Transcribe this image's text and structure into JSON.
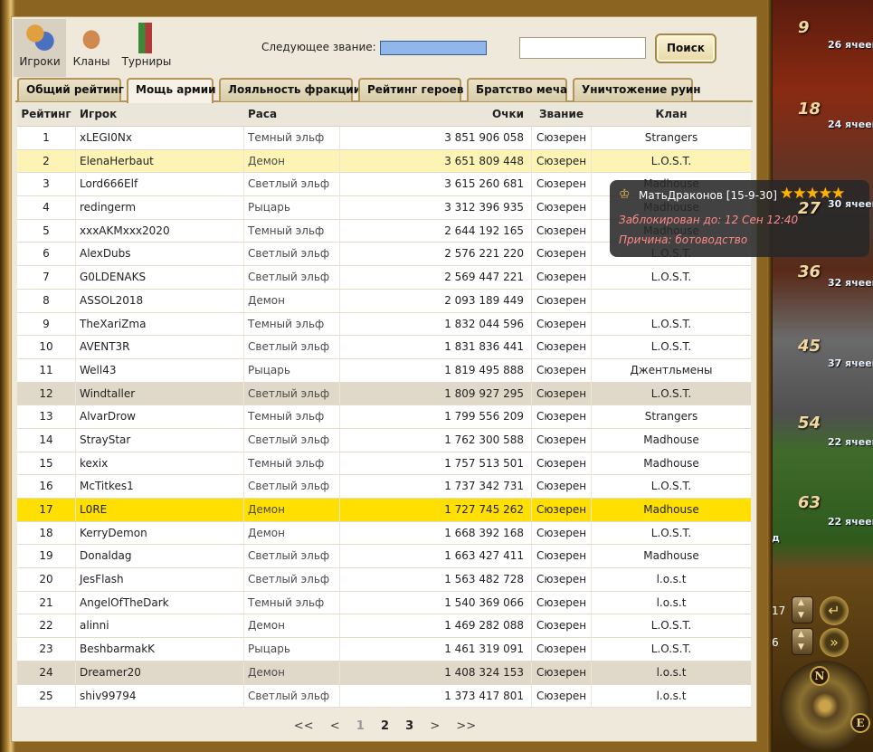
{
  "nav": {
    "players_label": "Игроки",
    "clans_label": "Кланы",
    "tournaments_label": "Турниры"
  },
  "next_rank_label": "Следующее звание:",
  "next_rank_progress": 1.0,
  "search": {
    "value": "",
    "button_label": "Поиск"
  },
  "tabs": [
    "Общий рейтинг",
    "Мощь армии",
    "Лояльность фракции",
    "Рейтинг героев",
    "Братство меча",
    "Уничтожение руин"
  ],
  "active_tab": "Мощь армии",
  "columns": [
    "Рейтинг",
    "Игрок",
    "Раса",
    "Очки",
    "Звание",
    "Клан"
  ],
  "rows": [
    [
      "1",
      "xLEGI0Nx",
      "Темный эльф",
      "3 851 906 058",
      "Сюзерен",
      "Strangers"
    ],
    [
      "2",
      "ElenaHerbaut",
      "Демон",
      "3 651 809 448",
      "Сюзерен",
      "L.O.S.T."
    ],
    [
      "3",
      "Lord666Elf",
      "Светлый эльф",
      "3 615 260 681",
      "Сюзерен",
      "Madhouse"
    ],
    [
      "4",
      "redingerm",
      "Рыцарь",
      "3 312 396 935",
      "Сюзерен",
      "Madhouse"
    ],
    [
      "5",
      "xxxAKMxxx2020",
      "Темный эльф",
      "2 644 192 165",
      "Сюзерен",
      "Madhouse"
    ],
    [
      "6",
      "AlexDubs",
      "Светлый эльф",
      "2 576 221 220",
      "Сюзерен",
      "L.O.S.T."
    ],
    [
      "7",
      "G0LDENAKS",
      "Светлый эльф",
      "2 569 447 221",
      "Сюзерен",
      "L.O.S.T."
    ],
    [
      "8",
      "ASSOL2018",
      "Демон",
      "2 093 189 449",
      "Сюзерен",
      ""
    ],
    [
      "9",
      "TheXariZma",
      "Темный эльф",
      "1 832 044 596",
      "Сюзерен",
      "L.O.S.T."
    ],
    [
      "10",
      "AVENT3R",
      "Светлый эльф",
      "1 831 836 441",
      "Сюзерен",
      "L.O.S.T."
    ],
    [
      "11",
      "Well43",
      "Рыцарь",
      "1 819 495 888",
      "Сюзерен",
      "Джентльмены"
    ],
    [
      "12",
      "Windtaller",
      "Светлый эльф",
      "1 809 927 295",
      "Сюзерен",
      "L.O.S.T."
    ],
    [
      "13",
      "AlvarDrow",
      "Темный эльф",
      "1 799 556 209",
      "Сюзерен",
      "Strangers"
    ],
    [
      "14",
      "StrayStar",
      "Светлый эльф",
      "1 762 300 588",
      "Сюзерен",
      "Madhouse"
    ],
    [
      "15",
      "kexix",
      "Темный эльф",
      "1 757 513 501",
      "Сюзерен",
      "Madhouse"
    ],
    [
      "16",
      "McTitkes1",
      "Светлый эльф",
      "1 737 342 731",
      "Сюзерен",
      "L.O.S.T."
    ],
    [
      "17",
      "L0RE",
      "Демон",
      "1 727 745 262",
      "Сюзерен",
      "Madhouse"
    ],
    [
      "18",
      "KerryDemon",
      "Демон",
      "1 668 392 168",
      "Сюзерен",
      "L.O.S.T."
    ],
    [
      "19",
      "Donaldag",
      "Светлый эльф",
      "1 663 427 411",
      "Сюзерен",
      "Madhouse"
    ],
    [
      "20",
      "JesFlash",
      "Светлый эльф",
      "1 563 482 728",
      "Сюзерен",
      "l.o.s.t"
    ],
    [
      "21",
      "AngelOfTheDark",
      "Темный эльф",
      "1 540 369 066",
      "Сюзерен",
      "l.o.s.t"
    ],
    [
      "22",
      "alinni",
      "Демон",
      "1 469 282 088",
      "Сюзерен",
      "L.O.S.T."
    ],
    [
      "23",
      "BeshbarmakK",
      "Рыцарь",
      "1 461 319 091",
      "Сюзерен",
      "L.O.S.T."
    ],
    [
      "24",
      "Dreamer20",
      "Демон",
      "1 408 324 153",
      "Сюзерен",
      "l.o.s.t"
    ],
    [
      "25",
      "shiv99794",
      "Светлый эльф",
      "1 373 417 801",
      "Сюзерен",
      "l.o.s.t"
    ]
  ],
  "row_highlights": {
    "2": "#fdf3b4",
    "12": "#e0d9c9",
    "17": "#ffdf00",
    "24": "#e0d9c9"
  },
  "pager": {
    "first": "<<",
    "prev": "<",
    "pages": [
      "1",
      "2",
      "3"
    ],
    "next": ">",
    "last": ">>"
  },
  "tooltip": {
    "name": "МатьДраконов [15-9-30]",
    "stars": "★★★★★",
    "banned_until": "Заблокирован до:  12 Сен 12:40",
    "reason": "Причина:  ботоводство"
  },
  "map": {
    "levels": [
      "9",
      "18",
      "27",
      "36",
      "45",
      "54",
      "63"
    ],
    "cells": [
      "26 ячеек",
      "24 ячеек",
      "30 ячеек",
      "32 ячеек",
      "37 ячеек",
      "22 ячеек",
      "22 ячеек"
    ],
    "counter_a": "17",
    "counter_b": "6",
    "compass_n": "N",
    "compass_e": "E",
    "partial_text": "д"
  },
  "colors": {
    "accent_gold": "#ffdf00",
    "progress_blue": "#8fb7ea",
    "tooltip_red": "#ff8a8a",
    "star": "#ffb300"
  }
}
